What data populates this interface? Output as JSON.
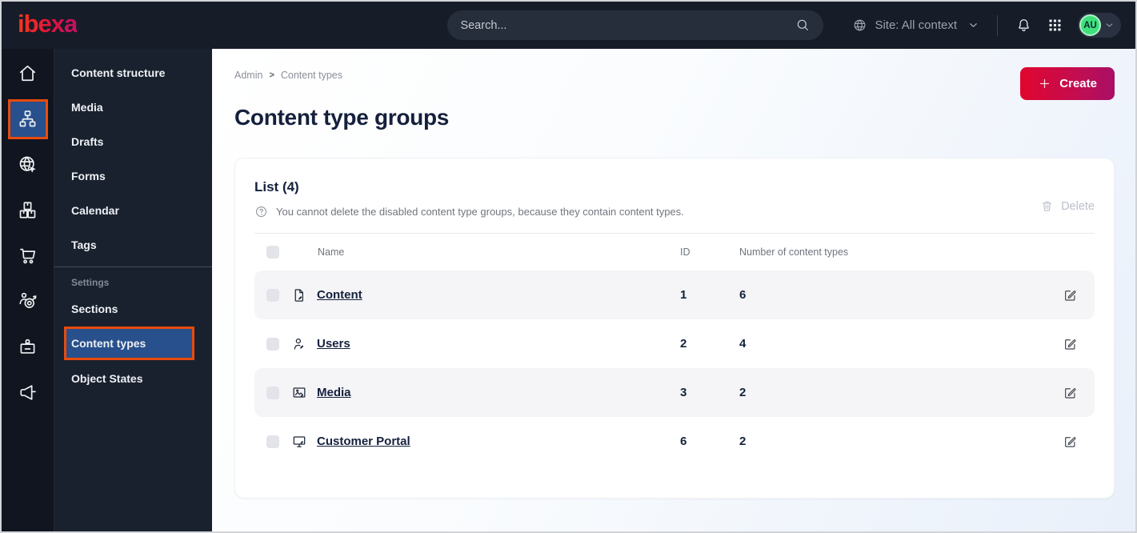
{
  "topbar": {
    "logo": "ibexa",
    "search": {
      "placeholder": "Search...",
      "icon": "search-icon"
    },
    "site_switcher": {
      "label": "Site: All context",
      "icon": "globe-icon",
      "chevron": "chevron-down-icon"
    },
    "notifications_icon": "bell-icon",
    "app_grid_icon": "grid-icon",
    "avatar": {
      "initials": "AU",
      "chevron": "chevron-down-icon"
    }
  },
  "icon_rail": {
    "items": [
      {
        "name": "dashboard",
        "icon": "home-icon",
        "active": false
      },
      {
        "name": "content",
        "icon": "sitemap-icon",
        "active": true
      },
      {
        "name": "site",
        "icon": "globe-cursor-icon",
        "active": false
      },
      {
        "name": "product-catalog",
        "icon": "boxes-icon",
        "active": false
      },
      {
        "name": "commerce",
        "icon": "cart-icon",
        "active": false
      },
      {
        "name": "personalization",
        "icon": "person-target-icon",
        "active": false
      },
      {
        "name": "admin",
        "icon": "badge-icon",
        "active": false
      },
      {
        "name": "campaigns",
        "icon": "megaphone-icon",
        "active": false
      }
    ]
  },
  "sidebar": {
    "items": [
      {
        "label": "Content structure"
      },
      {
        "label": "Media"
      },
      {
        "label": "Drafts"
      },
      {
        "label": "Forms"
      },
      {
        "label": "Calendar"
      },
      {
        "label": "Tags"
      }
    ],
    "section_label": "Settings",
    "settings_items": [
      {
        "label": "Sections",
        "active": false
      },
      {
        "label": "Content types",
        "active": true
      },
      {
        "label": "Object States",
        "active": false
      }
    ]
  },
  "main": {
    "breadcrumb": {
      "items": [
        "Admin",
        "Content types"
      ],
      "separator": ">"
    },
    "create_button": {
      "label": "Create",
      "icon": "plus-icon"
    },
    "page_title": "Content type groups",
    "list_card": {
      "title": "List (4)",
      "info_icon": "question-icon",
      "info": "You cannot delete the disabled content type groups, because they contain content types.",
      "delete_button": {
        "label": "Delete",
        "icon": "trash-icon",
        "disabled": true
      },
      "table": {
        "columns": [
          "Name",
          "ID",
          "Number of content types"
        ],
        "edit_icon": "edit-icon",
        "rows": [
          {
            "name": "Content",
            "icon": "file-icon",
            "id": "1",
            "count": "6"
          },
          {
            "name": "Users",
            "icon": "user-icon",
            "id": "2",
            "count": "4"
          },
          {
            "name": "Media",
            "icon": "image-icon",
            "id": "3",
            "count": "2"
          },
          {
            "name": "Customer Portal",
            "icon": "monitor-icon",
            "id": "6",
            "count": "2"
          }
        ]
      }
    }
  },
  "colors": {
    "topbar_bg": "#161c28",
    "rail_bg": "#10151f",
    "sidebar_bg": "#1a212e",
    "active_blue": "#27508c",
    "annotation_orange": "#e84b0c",
    "accent_red": "#e0062e",
    "accent_magenta": "#a90f66",
    "avatar_green": "#3fe07c",
    "text_dark": "#14203c",
    "row_stripe": "#f5f5f7"
  }
}
